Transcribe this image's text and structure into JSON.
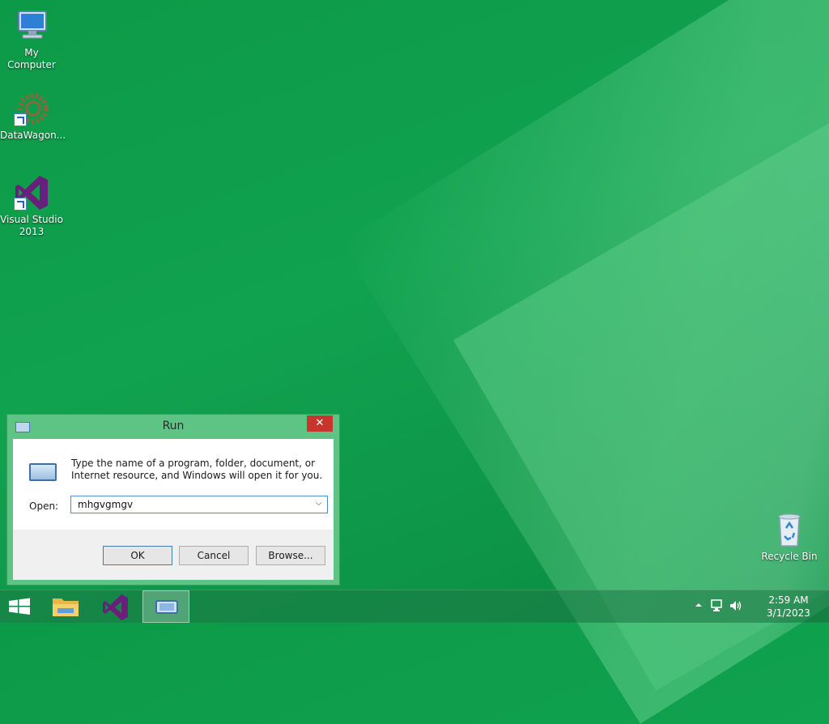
{
  "desktop": {
    "icons": [
      {
        "label": "My Computer"
      },
      {
        "label": "DataWagon..."
      },
      {
        "label": "Visual Studio 2013"
      },
      {
        "label": "Recycle Bin"
      }
    ]
  },
  "run_dialog": {
    "title": "Run",
    "close_glyph": "✕",
    "message": "Type the name of a program, folder, document, or Internet resource, and Windows will open it for you.",
    "open_label": "Open:",
    "open_value": "mhgvgmgv",
    "buttons": {
      "ok": "OK",
      "cancel": "Cancel",
      "browse": "Browse..."
    }
  },
  "taskbar": {
    "clock": {
      "time": "2:59 AM",
      "date": "3/1/2023"
    },
    "tray_icons": [
      "show-hidden-icons-icon",
      "network-icon",
      "volume-icon"
    ]
  },
  "colors": {
    "wallpaper": "#10a24f",
    "dialog_frame": "#5dc486",
    "close_button": "#c7352c",
    "input_border": "#4d8ed1"
  }
}
